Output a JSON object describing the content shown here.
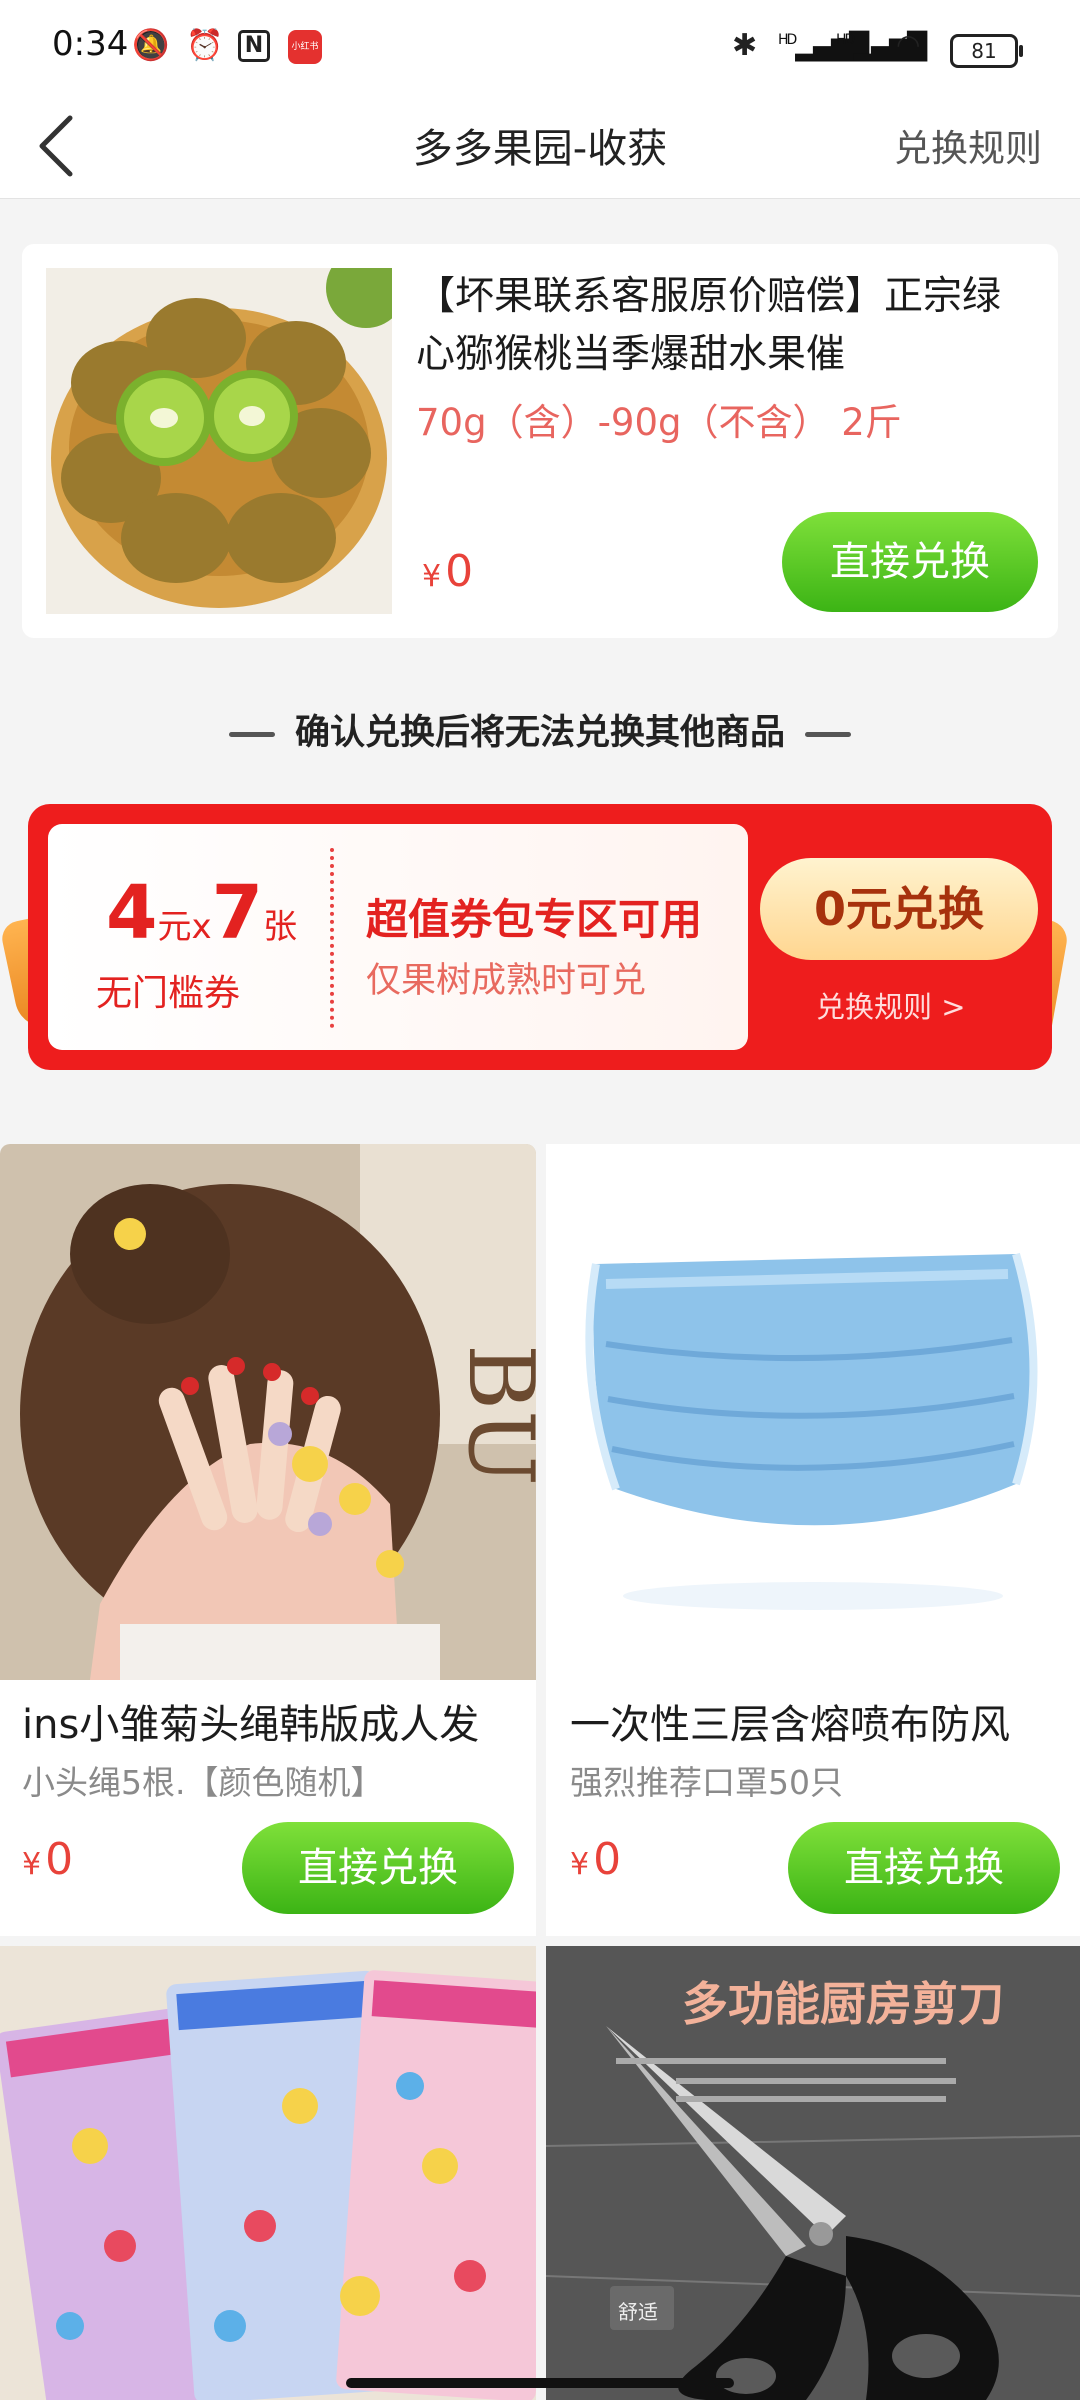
{
  "status_bar": {
    "time": "0:34",
    "app_badge": "小红书",
    "signal_1": "HD",
    "signal_2": "HD",
    "battery": "81"
  },
  "nav": {
    "title": "多多果园-收获",
    "rules_link": "兑换规则"
  },
  "featured": {
    "title": "【坏果联系客服原价赔偿】正宗绿心猕猴桃当季爆甜水果催",
    "spec": "70g（含）-90g（不含） 2斤",
    "currency": "¥",
    "price": "0",
    "button": "直接兑换"
  },
  "notice": "确认兑换后将无法兑换其他商品",
  "coupon": {
    "amount": "4",
    "unit": "元",
    "times": "x",
    "count": "7",
    "count_unit": "张",
    "type": "无门槛券",
    "headline": "超值券包专区可用",
    "condition": "仅果树成熟时可兑",
    "button": "0元兑换",
    "rules": "兑换规则 >"
  },
  "products": [
    {
      "name": "ins小雏菊头绳韩版成人发",
      "sub": "小头绳5根.【颜色随机】",
      "currency": "¥",
      "price": "0",
      "button": "直接兑换"
    },
    {
      "name": "一次性三层含熔喷布防风",
      "sub": "强烈推荐口罩50只",
      "currency": "¥",
      "price": "0",
      "button": "直接兑换"
    }
  ],
  "scissors_banner": {
    "title": "多功能厨房剪刀",
    "brand": "舒适"
  },
  "colors": {
    "accent_red": "#e8423a",
    "button_green": "#3cb415",
    "coupon_red": "#ee1d1d"
  }
}
